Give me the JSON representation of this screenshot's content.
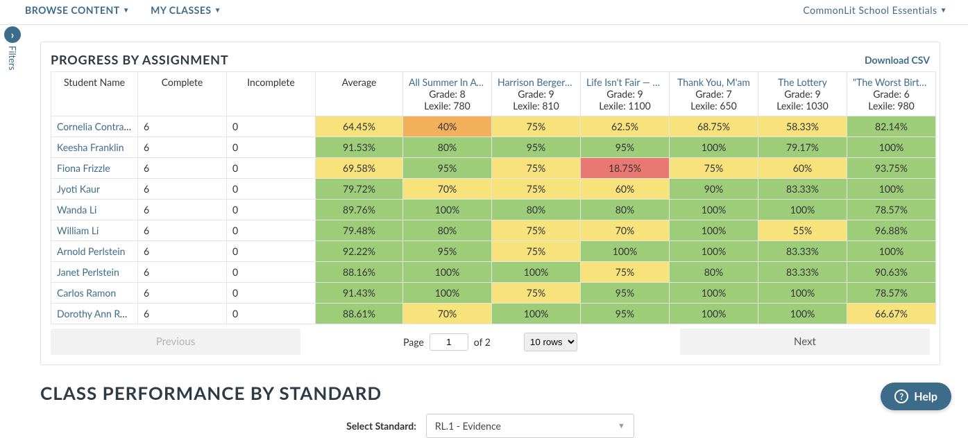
{
  "nav": {
    "browse": "BROWSE CONTENT",
    "myclasses": "MY CLASSES",
    "right": "CommonLit School Essentials"
  },
  "filters_label": "Filters",
  "section_title": "PROGRESS BY ASSIGNMENT",
  "download_label": "Download CSV",
  "headers": {
    "name": "Student Name",
    "complete": "Complete",
    "incomplete": "Incomplete",
    "average": "Average"
  },
  "assignments": [
    {
      "title": "All Summer In A Day",
      "grade": "Grade:  8",
      "lexile": "Lexile:  780"
    },
    {
      "title": "Harrison Bergeron",
      "grade": "Grade:  9",
      "lexile": "Lexile:  810"
    },
    {
      "title": "Life Isn't Fair — Deal With It",
      "grade": "Grade:  9",
      "lexile": "Lexile:  1100"
    },
    {
      "title": "Thank You, M'am",
      "grade": "Grade:  7",
      "lexile": "Lexile:  650"
    },
    {
      "title": "The Lottery",
      "grade": "Grade:  9",
      "lexile": "Lexile:  1030"
    },
    {
      "title": "\"The Worst Birthday\"",
      "grade": "Grade:  6",
      "lexile": "Lexile:  980"
    }
  ],
  "rows": [
    {
      "name": "Cornelia Contralto",
      "complete": "6",
      "incomplete": "0",
      "avg": "64.45%",
      "scores": [
        {
          "v": "40%",
          "c": "orange"
        },
        {
          "v": "75%",
          "c": "yellow"
        },
        {
          "v": "62.5%",
          "c": "yellow"
        },
        {
          "v": "68.75%",
          "c": "yellow"
        },
        {
          "v": "58.33%",
          "c": "yellow"
        },
        {
          "v": "82.14%",
          "c": "green"
        }
      ],
      "avgc": "yellow"
    },
    {
      "name": "Keesha Franklin",
      "complete": "6",
      "incomplete": "0",
      "avg": "91.53%",
      "scores": [
        {
          "v": "80%",
          "c": "green"
        },
        {
          "v": "95%",
          "c": "green"
        },
        {
          "v": "95%",
          "c": "green"
        },
        {
          "v": "100%",
          "c": "green"
        },
        {
          "v": "79.17%",
          "c": "green"
        },
        {
          "v": "100%",
          "c": "green"
        }
      ],
      "avgc": "green"
    },
    {
      "name": "Fiona Frizzle",
      "complete": "6",
      "incomplete": "0",
      "avg": "69.58%",
      "scores": [
        {
          "v": "95%",
          "c": "green"
        },
        {
          "v": "75%",
          "c": "yellow"
        },
        {
          "v": "18.75%",
          "c": "red"
        },
        {
          "v": "75%",
          "c": "yellow"
        },
        {
          "v": "60%",
          "c": "yellow"
        },
        {
          "v": "93.75%",
          "c": "green"
        }
      ],
      "avgc": "yellow"
    },
    {
      "name": "Jyoti Kaur",
      "complete": "6",
      "incomplete": "0",
      "avg": "79.72%",
      "scores": [
        {
          "v": "70%",
          "c": "yellow"
        },
        {
          "v": "75%",
          "c": "yellow"
        },
        {
          "v": "60%",
          "c": "yellow"
        },
        {
          "v": "90%",
          "c": "green"
        },
        {
          "v": "83.33%",
          "c": "green"
        },
        {
          "v": "100%",
          "c": "green"
        }
      ],
      "avgc": "green"
    },
    {
      "name": "Wanda Li",
      "complete": "6",
      "incomplete": "0",
      "avg": "89.76%",
      "scores": [
        {
          "v": "100%",
          "c": "green"
        },
        {
          "v": "80%",
          "c": "green"
        },
        {
          "v": "80%",
          "c": "green"
        },
        {
          "v": "100%",
          "c": "green"
        },
        {
          "v": "100%",
          "c": "green"
        },
        {
          "v": "78.57%",
          "c": "green"
        }
      ],
      "avgc": "green"
    },
    {
      "name": "William Li",
      "complete": "6",
      "incomplete": "0",
      "avg": "79.48%",
      "scores": [
        {
          "v": "80%",
          "c": "green"
        },
        {
          "v": "75%",
          "c": "yellow"
        },
        {
          "v": "70%",
          "c": "yellow"
        },
        {
          "v": "100%",
          "c": "green"
        },
        {
          "v": "55%",
          "c": "yellow"
        },
        {
          "v": "96.88%",
          "c": "green"
        }
      ],
      "avgc": "green"
    },
    {
      "name": "Arnold Perlstein",
      "complete": "6",
      "incomplete": "0",
      "avg": "92.22%",
      "scores": [
        {
          "v": "95%",
          "c": "green"
        },
        {
          "v": "75%",
          "c": "yellow"
        },
        {
          "v": "100%",
          "c": "green"
        },
        {
          "v": "100%",
          "c": "green"
        },
        {
          "v": "83.33%",
          "c": "green"
        },
        {
          "v": "100%",
          "c": "green"
        }
      ],
      "avgc": "green"
    },
    {
      "name": "Janet Perlstein",
      "complete": "6",
      "incomplete": "0",
      "avg": "88.16%",
      "scores": [
        {
          "v": "100%",
          "c": "green"
        },
        {
          "v": "100%",
          "c": "green"
        },
        {
          "v": "75%",
          "c": "yellow"
        },
        {
          "v": "80%",
          "c": "green"
        },
        {
          "v": "83.33%",
          "c": "green"
        },
        {
          "v": "90.63%",
          "c": "green"
        }
      ],
      "avgc": "green"
    },
    {
      "name": "Carlos Ramon",
      "complete": "6",
      "incomplete": "0",
      "avg": "91.43%",
      "scores": [
        {
          "v": "100%",
          "c": "green"
        },
        {
          "v": "75%",
          "c": "yellow"
        },
        {
          "v": "95%",
          "c": "green"
        },
        {
          "v": "100%",
          "c": "green"
        },
        {
          "v": "100%",
          "c": "green"
        },
        {
          "v": "78.57%",
          "c": "green"
        }
      ],
      "avgc": "green"
    },
    {
      "name": "Dorothy Ann Rourke",
      "complete": "6",
      "incomplete": "0",
      "avg": "88.61%",
      "scores": [
        {
          "v": "70%",
          "c": "yellow"
        },
        {
          "v": "100%",
          "c": "green"
        },
        {
          "v": "95%",
          "c": "green"
        },
        {
          "v": "100%",
          "c": "green"
        },
        {
          "v": "100%",
          "c": "green"
        },
        {
          "v": "66.67%",
          "c": "yellow"
        }
      ],
      "avgc": "green"
    }
  ],
  "pager": {
    "prev": "Previous",
    "next": "Next",
    "page_label": "Page",
    "page_value": "1",
    "of_text": "of 2",
    "rows_option": "10 rows"
  },
  "standard_section": {
    "title": "CLASS PERFORMANCE BY STANDARD",
    "label": "Select Standard:",
    "value": "RL.1 - Evidence"
  },
  "help_label": "Help"
}
